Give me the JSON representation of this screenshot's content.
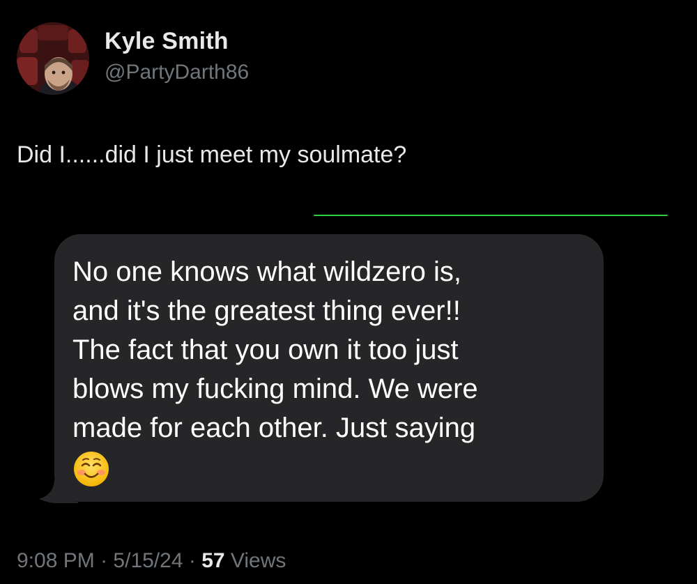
{
  "author": {
    "name": "Kyle Smith",
    "handle": "@PartyDarth86",
    "avatar_icon": "profile-photo-avatar"
  },
  "tweet": {
    "text": "Did I......did I just meet my soulmate?"
  },
  "embedded_message": {
    "text": "No one knows what wildzero is,\nand it's the greatest thing ever!!\nThe fact that you own it too just\nblows my fucking mind. We were\nmade for each other. Just saying",
    "emoji_icon": "smiling-face-with-blush-emoji",
    "bubble_color": "#262628"
  },
  "meta": {
    "time": "9:08 PM",
    "separator": "·",
    "date": "5/15/24",
    "views_count": "57",
    "views_label": "Views"
  },
  "colors": {
    "background": "#000000",
    "secondary_text": "#71767b",
    "accent_line": "#2ecc40"
  }
}
